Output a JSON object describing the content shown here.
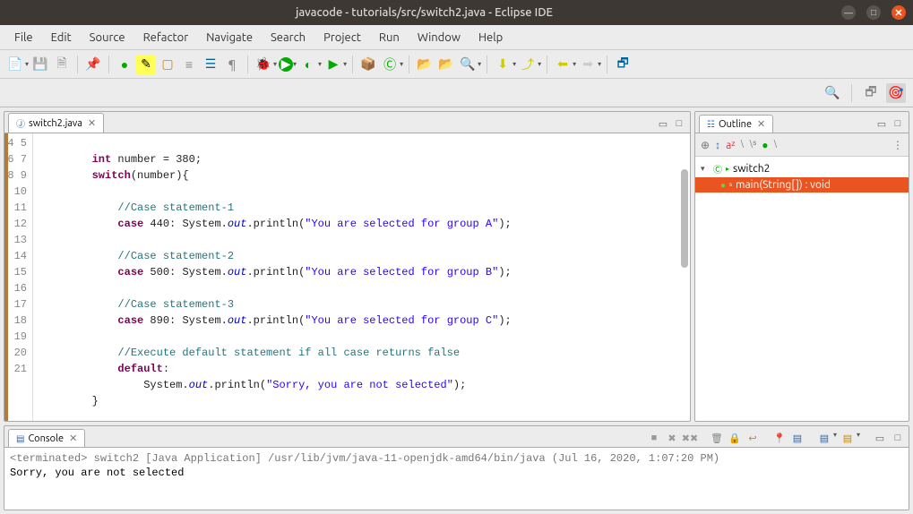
{
  "titlebar": {
    "title": "javacode - tutorials/src/switch2.java - Eclipse IDE"
  },
  "menubar": [
    "File",
    "Edit",
    "Source",
    "Refactor",
    "Navigate",
    "Search",
    "Project",
    "Run",
    "Window",
    "Help"
  ],
  "editor": {
    "tab": {
      "label": "switch2.java"
    },
    "first_line": 4,
    "lines": [
      "",
      "        int number = 380;",
      "        switch(number){",
      "",
      "            //Case statement-1",
      "            case 440: System.out.println(\"You are selected for group A\");",
      "",
      "            //Case statement-2",
      "            case 500: System.out.println(\"You are selected for group B\");",
      "",
      "            //Case statement-3",
      "            case 890: System.out.println(\"You are selected for group C\");",
      "",
      "            //Execute default statement if all case returns false",
      "            default:",
      "                System.out.println(\"Sorry, you are not selected\");",
      "        }",
      ""
    ]
  },
  "outline": {
    "title": "Outline",
    "root": "switch2",
    "child": "main(String[]) : void"
  },
  "console": {
    "title": "Console",
    "terminated": "<terminated> switch2 [Java Application] /usr/lib/jvm/java-11-openjdk-amd64/bin/java (Jul 16, 2020, 1:07:20 PM)",
    "output": "Sorry, you are not selected"
  }
}
